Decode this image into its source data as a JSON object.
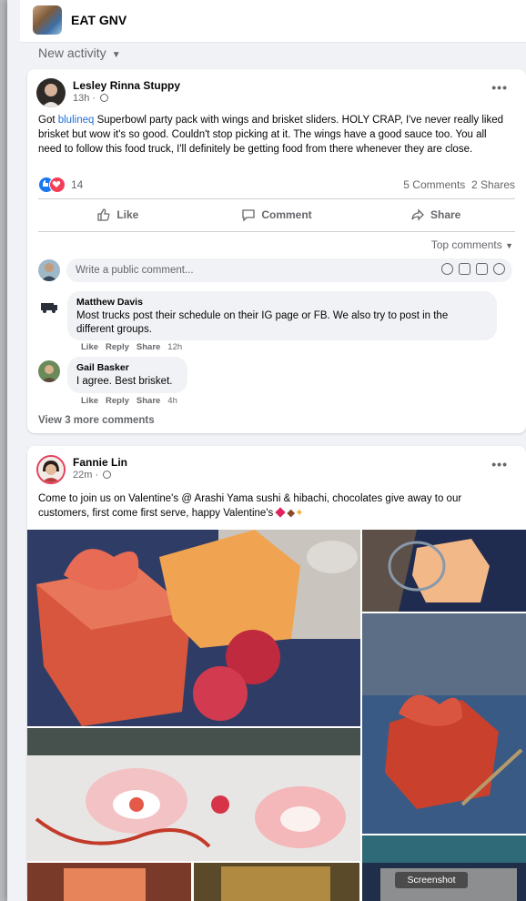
{
  "group": {
    "name": "EAT GNV"
  },
  "feed": {
    "sort_label": "New activity"
  },
  "post1": {
    "author": "Lesley Rinna Stuppy",
    "time": "13h",
    "text_link": "blulineq",
    "text_body": " Superbowl party pack with wings and brisket sliders.  HOLY CRAP, I've never really liked brisket but wow it's so good.  Couldn't stop picking at it.  The wings have a good sauce too. You all need to follow this food truck, I'll definitely be getting food from there whenever they are close.",
    "reaction_count": "14",
    "comments_count": "5 Comments",
    "shares_count": "2 Shares",
    "actions": {
      "like": "Like",
      "comment": "Comment",
      "share": "Share"
    },
    "comment_sort": "Top comments",
    "comment_placeholder": "Write a public comment...",
    "comments": [
      {
        "name": "Matthew Davis",
        "text": "Most trucks post their schedule on their IG page or FB. We also try to post in the different groups.",
        "like": "Like",
        "reply": "Reply",
        "share": "Share",
        "time": "12h"
      },
      {
        "name": "Gail Basker",
        "text": "I agree. Best brisket.",
        "like": "Like",
        "reply": "Reply",
        "share": "Share",
        "time": "4h"
      }
    ],
    "view_more": "View 3 more comments"
  },
  "post2": {
    "author": "Fannie Lin",
    "time": "22m",
    "text": "Come to join us on Valentine's @ Arashi Yama sushi & hibachi, chocolates give away to our customers, first come first serve, happy Valentine's"
  },
  "tooltip": {
    "label": "Screenshot"
  },
  "colors": {
    "brand_blue": "#1877f2",
    "link": "#216fdb",
    "love_red": "#f33e58",
    "text_secondary": "#65676b",
    "feed_bg": "#f0f2f5"
  }
}
